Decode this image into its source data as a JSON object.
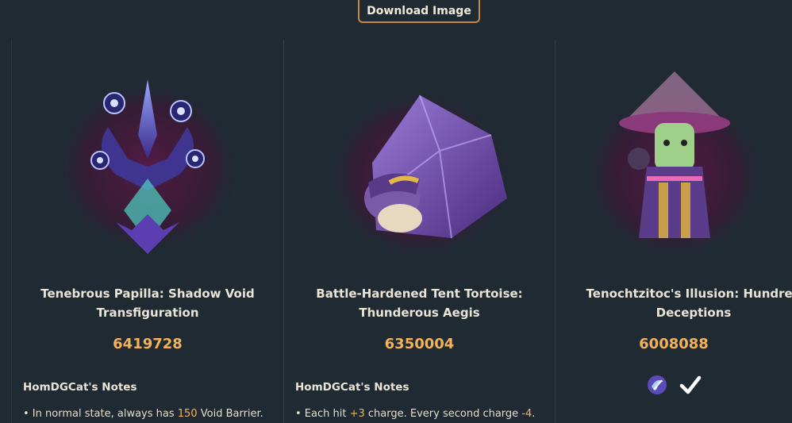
{
  "header": {
    "download_label": "Download Image"
  },
  "cards": [
    {
      "title": "Tenebrous Papilla: Shadow Void Transfiguration",
      "score": "6419728",
      "notes_heading": "HomDGCat's Notes",
      "note": {
        "prefix": "• In normal state, always has ",
        "highlight": "150",
        "suffix": " Void Barrier."
      }
    },
    {
      "title": "Battle-Hardened Tent Tortoise: Thunderous Aegis",
      "score": "6350004",
      "notes_heading": "HomDGCat's Notes",
      "note": {
        "prefix": "• Each hit ",
        "highlight": "+3",
        "middle": " charge. Every second charge ",
        "highlight2": "-4",
        "suffix": "."
      }
    },
    {
      "title": "Tenochtzitoc's Illusion: Hundred Deceptions",
      "score": "6008088",
      "icons": [
        "swirl-emblem-icon",
        "checkmark-icon"
      ]
    }
  ],
  "colors": {
    "accent": "#f2b25c",
    "button_border": "#c9893f",
    "background": "#1f2a33"
  }
}
